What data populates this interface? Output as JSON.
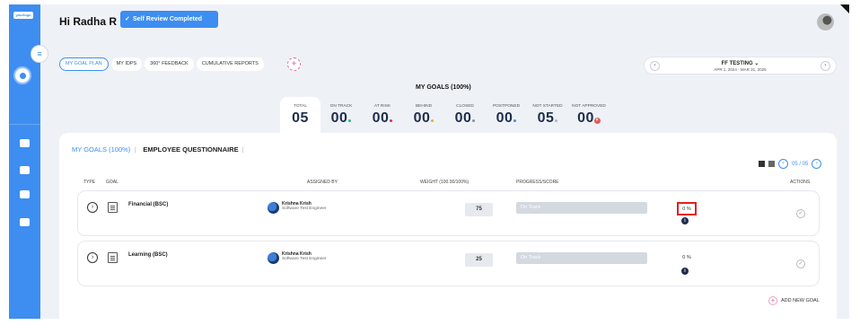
{
  "header": {
    "greeting": "Hi Radha R",
    "review_badge": "Self Review Completed"
  },
  "rail": {
    "logo_text": "yourlogo"
  },
  "tabs": [
    "MY GOAL PLAN",
    "MY IDPS",
    "360° FEEDBACK",
    "CUMULATIVE REPORTS"
  ],
  "period": {
    "name": "FF TESTING",
    "dates": "APR 1, 2024 - MAR 31, 2025"
  },
  "goals_title": "MY GOALS (100%)",
  "stats": [
    {
      "label": "TOTAL",
      "value": "05",
      "dot": ""
    },
    {
      "label": "ON TRACK",
      "value": "00",
      "dot": "#2eb872"
    },
    {
      "label": "AT RISK",
      "value": "00",
      "dot": "#e0303a"
    },
    {
      "label": "BEHIND",
      "value": "00",
      "dot": "#f2a23a"
    },
    {
      "label": "CLOSED",
      "value": "00",
      "dot": "#8a8f99"
    },
    {
      "label": "POSTPONED",
      "value": "00",
      "dot": "#3d8ef0"
    },
    {
      "label": "NOT STARTED",
      "value": "05",
      "dot": "#b0b5bd"
    },
    {
      "label": "NOT APPROVED",
      "value": "00",
      "dot": "x"
    }
  ],
  "card": {
    "tab_goals": "MY GOALS (100%)",
    "tab_questionnaire": "EMPLOYEE QUESTIONNAIRE",
    "pagination": "05 / 05",
    "headers": {
      "type": "TYPE",
      "goal": "GOAL",
      "assigned_by": "ASSIGNED BY",
      "weight": "WEIGHT (100.00/100%)",
      "progress": "PROGRESS/SCORE",
      "actions": "ACTIONS"
    },
    "rows": [
      {
        "goal": "Financial (BSC)",
        "assignee": "Krishna Krish",
        "role": "Software Test Engineer",
        "weight": "75",
        "status": "On Track",
        "percent": "0 %"
      },
      {
        "goal": "Learning (BSC)",
        "assignee": "Krishna Krish",
        "role": "Software Test Engineer",
        "weight": "25",
        "status": "On Track",
        "percent": "0 %"
      }
    ],
    "add_goal": "ADD NEW GOAL"
  },
  "colors": {
    "accent": "#3d8ef0",
    "panel_bg": "#eef2f7",
    "highlight": "#e02020"
  }
}
